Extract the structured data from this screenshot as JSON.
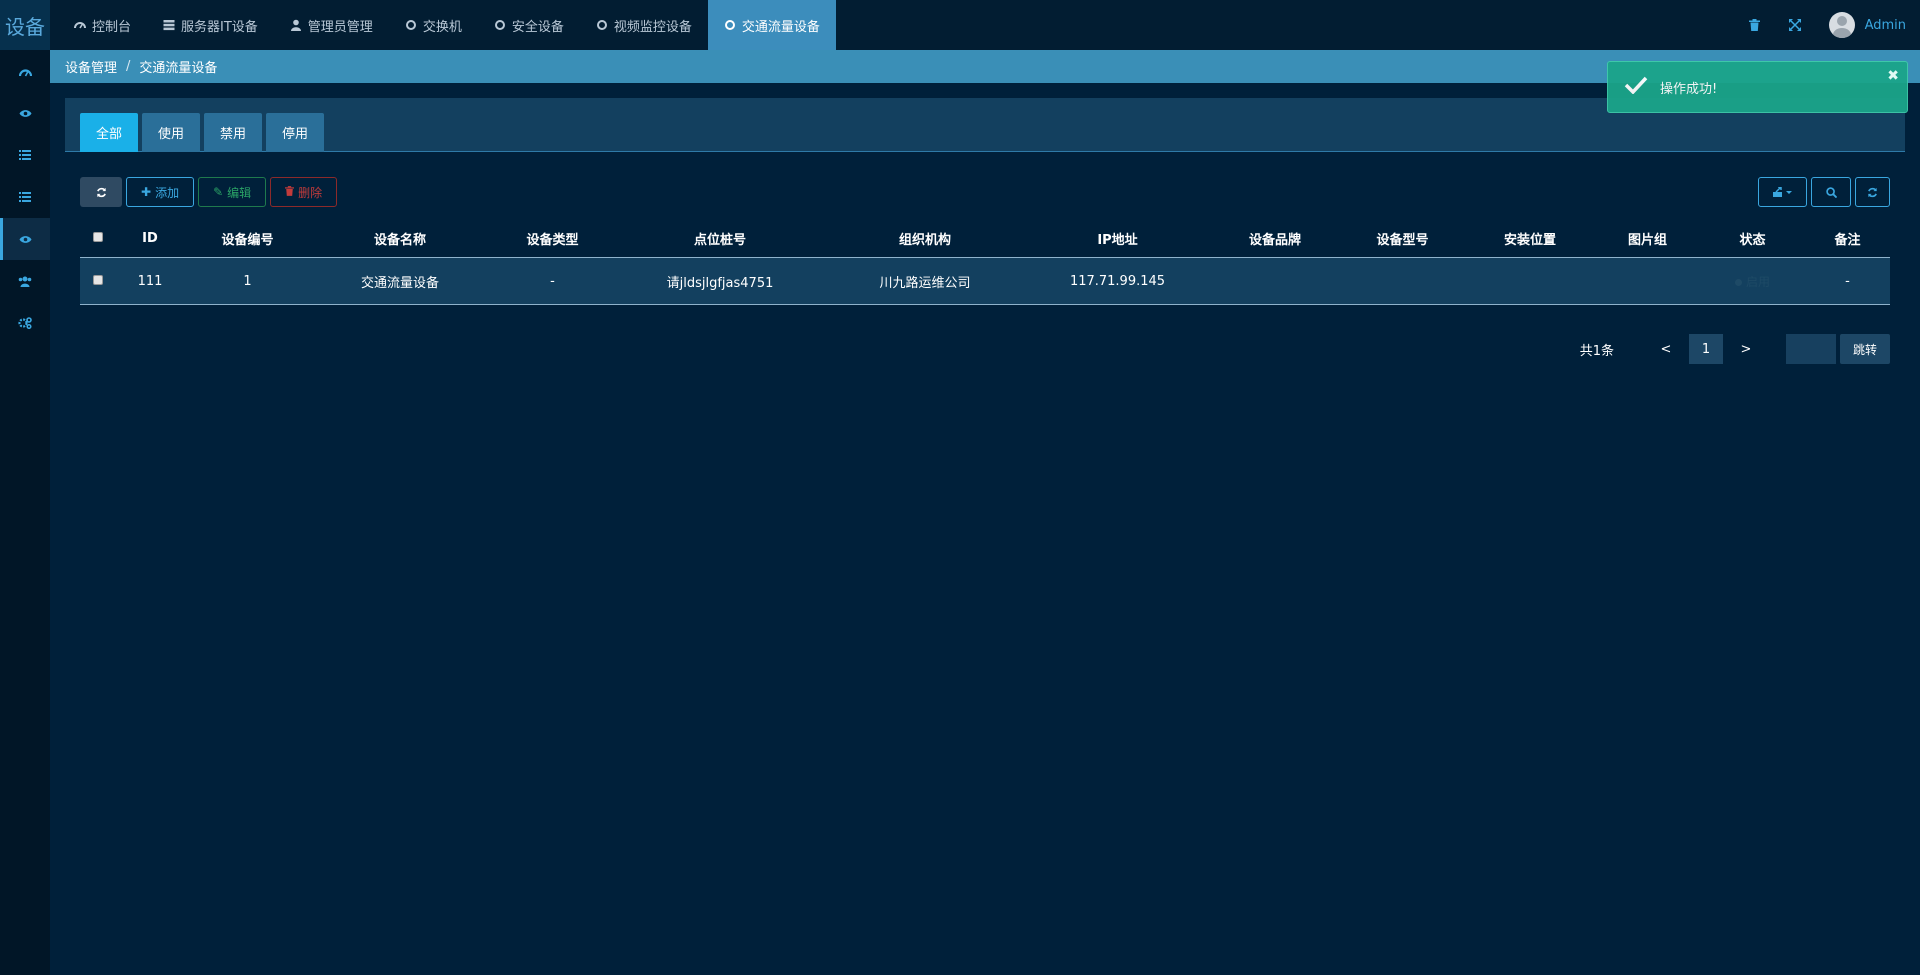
{
  "brand": "设备",
  "topnav": [
    {
      "label": "控制台",
      "icon": "dashboard-icon"
    },
    {
      "label": "服务器IT设备",
      "icon": "server-icon"
    },
    {
      "label": "管理员管理",
      "icon": "user-icon"
    },
    {
      "label": "交换机",
      "icon": "circle-icon"
    },
    {
      "label": "安全设备",
      "icon": "circle-icon"
    },
    {
      "label": "视频监控设备",
      "icon": "circle-icon"
    },
    {
      "label": "交通流量设备",
      "icon": "circle-icon",
      "active": true
    }
  ],
  "user": {
    "name": "Admin"
  },
  "sidebar": [
    "dashboard-icon",
    "eye-icon",
    "list-icon",
    "list-icon",
    "eye-icon",
    "users-icon",
    "cogs-icon"
  ],
  "breadcrumb": {
    "parent": "设备管理",
    "separator": "/",
    "current": "交通流量设备"
  },
  "tabs": [
    {
      "label": "全部",
      "active": true
    },
    {
      "label": "使用"
    },
    {
      "label": "禁用"
    },
    {
      "label": "停用"
    }
  ],
  "toolbar": {
    "add": "添加",
    "edit": "编辑",
    "delete": "删除"
  },
  "table": {
    "columns": [
      "ID",
      "设备编号",
      "设备名称",
      "设备类型",
      "点位桩号",
      "组织机构",
      "IP地址",
      "设备品牌",
      "设备型号",
      "安装位置",
      "图片组",
      "状态",
      "备注"
    ],
    "rows": [
      [
        "111",
        "1",
        "交通流量设备",
        "-",
        "请jldsjlgfjas4751",
        "川九路运维公司",
        "117.71.99.145",
        "",
        "",
        "",
        "",
        "启用",
        "-"
      ]
    ]
  },
  "pagination": {
    "total": "共1条",
    "prev": "<",
    "current": "1",
    "next": ">",
    "jump": "跳转"
  },
  "toast": {
    "message": "操作成功!"
  },
  "colors": {
    "accent": "#3c8dbc",
    "tab_active": "#1ab0e8",
    "toast": "#1ba58a",
    "background": "#00203a"
  }
}
